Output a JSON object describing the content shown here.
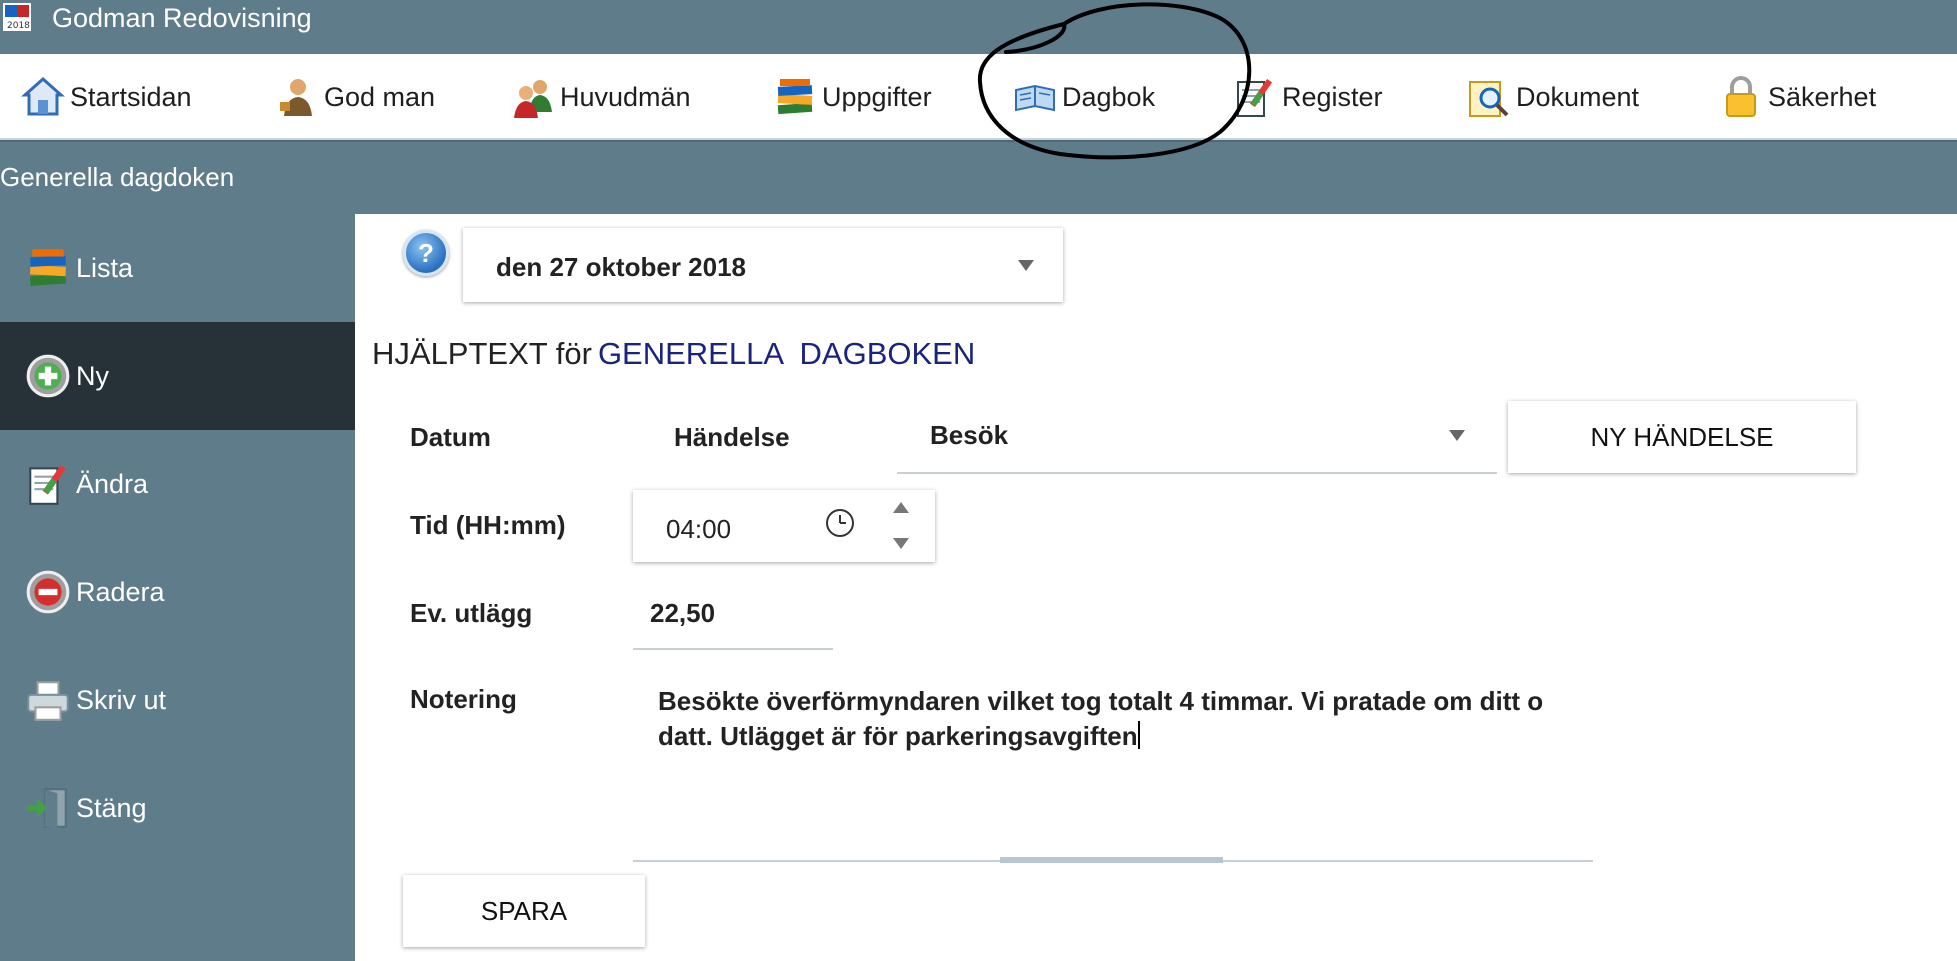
{
  "app": {
    "title": "Godman Redovisning",
    "icon": "app-logo-icon"
  },
  "menu": [
    {
      "label": "Startsidan",
      "icon": "home-icon"
    },
    {
      "label": "God man",
      "icon": "person-icon"
    },
    {
      "label": "Huvudmän",
      "icon": "people-icon"
    },
    {
      "label": "Uppgifter",
      "icon": "books-icon"
    },
    {
      "label": "Dagbok",
      "icon": "open-book-icon"
    },
    {
      "label": "Register",
      "icon": "notepad-pencil-icon"
    },
    {
      "label": "Dokument",
      "icon": "document-magnifier-icon"
    },
    {
      "label": "Säkerhet",
      "icon": "padlock-icon"
    }
  ],
  "section": {
    "title": "Generella dagdoken"
  },
  "sidebar": [
    {
      "label": "Lista",
      "icon": "books-icon"
    },
    {
      "label": "Ny",
      "icon": "add-circle-icon",
      "active": true
    },
    {
      "label": "Ändra",
      "icon": "notepad-pencil-icon"
    },
    {
      "label": "Radera",
      "icon": "delete-circle-icon"
    },
    {
      "label": "Skriv ut",
      "icon": "printer-icon"
    },
    {
      "label": "Stäng",
      "icon": "exit-door-icon"
    }
  ],
  "form": {
    "date_value": "den 27 oktober 2018",
    "help_text_prefix": "HJÄLPTEXT för",
    "help_text_accent": "GENERELLA  DAGBOKEN",
    "labels": {
      "datum": "Datum",
      "handelse": "Händelse",
      "tid": "Tid (HH:mm)",
      "utlagg": "Ev. utlägg",
      "notering": "Notering"
    },
    "event_value": "Besök",
    "new_event_button": "NY HÄNDELSE",
    "time_value": "04:00",
    "amount_value": "22,50",
    "note_value": "Besökte överförmyndaren vilket tog totalt 4 timmar. Vi pratade om ditt o datt. Utlägget är för parkeringsavgiften",
    "save_button": "SPARA"
  },
  "colors": {
    "header_bg": "#5f7c8b",
    "sidebar_active_bg": "#263238",
    "help_accent": "#1a237e"
  }
}
